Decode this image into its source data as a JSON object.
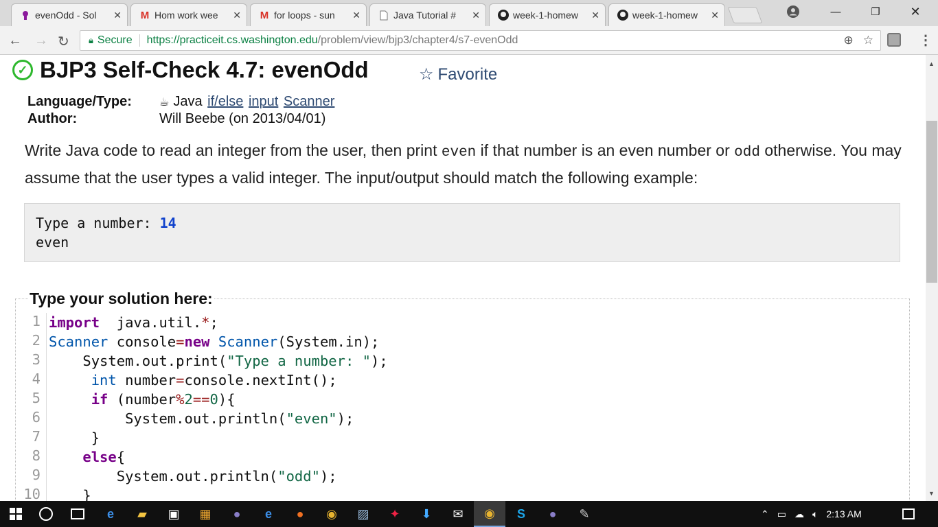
{
  "browser": {
    "tabs": [
      {
        "title": "evenOdd - Sol",
        "icon": "practiceit-icon",
        "active": true
      },
      {
        "title": "Hom work wee",
        "icon": "gmail-icon"
      },
      {
        "title": "for loops - sun",
        "icon": "gmail-icon"
      },
      {
        "title": "Java Tutorial #",
        "icon": "page-icon"
      },
      {
        "title": "week-1-homew",
        "icon": "github-icon"
      },
      {
        "title": "week-1-homew",
        "icon": "github-icon"
      }
    ],
    "secure_label": "Secure",
    "url_host": "https://practiceit.cs.washington.edu",
    "url_path": "/problem/view/bjp3/chapter4/s7-evenOdd"
  },
  "page": {
    "title": "BJP3 Self-Check 4.7: evenOdd",
    "favorite_label": "Favorite",
    "language_key": "Language/Type:",
    "language_value": "Java",
    "tags": [
      "if/else",
      "input",
      "Scanner"
    ],
    "author_key": "Author:",
    "author_value": "Will Beebe (on 2013/04/01)",
    "desc_part1": "Write Java code to read an integer from the user, then print ",
    "desc_even": "even",
    "desc_part2": " if that number is an even number or ",
    "desc_odd": "odd",
    "desc_part3": " otherwise. You may assume that the user types a valid integer. The input/output should match the following example:",
    "example_prompt": "Type a number: ",
    "example_input": "14",
    "example_output": "even",
    "solution_label": "Type your solution here:",
    "line_numbers": [
      "1",
      "2",
      "3",
      "4",
      "5",
      "6",
      "7",
      "8",
      "9",
      "10"
    ]
  },
  "taskbar": {
    "time": "2:13 AM"
  }
}
